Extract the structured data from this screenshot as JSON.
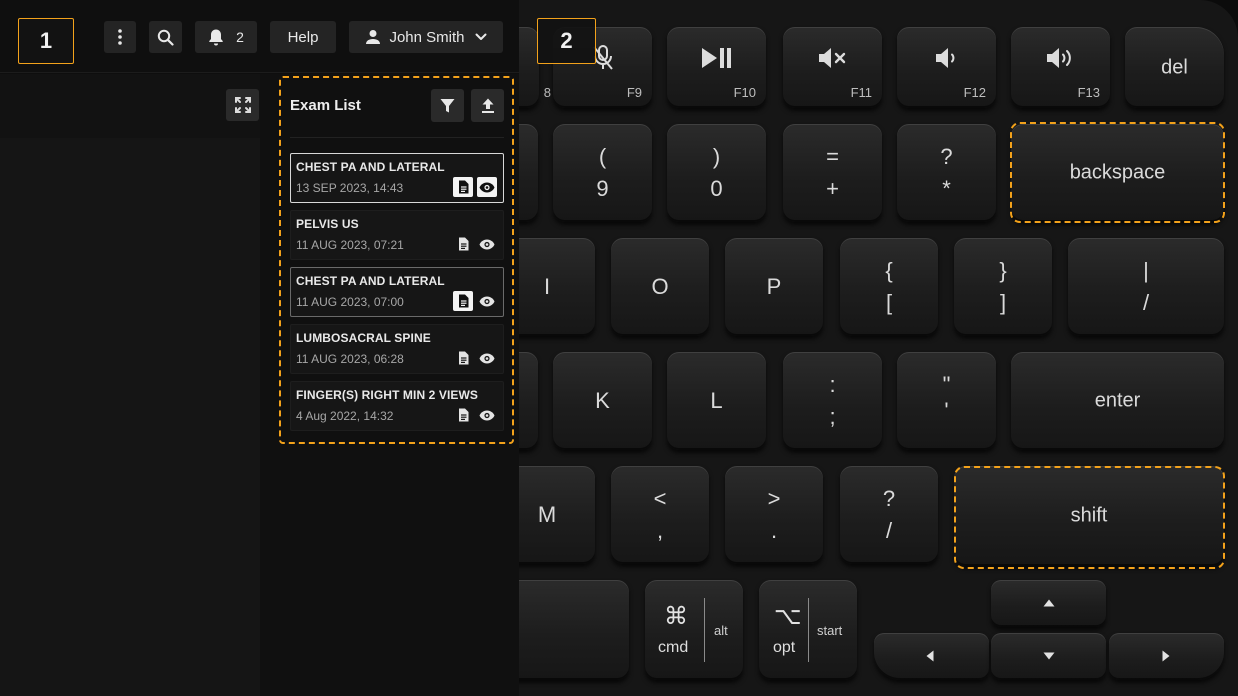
{
  "callouts": {
    "one": "1",
    "two": "2"
  },
  "topbar": {
    "notification_count": "2",
    "help_label": "Help",
    "user_name": "John Smith"
  },
  "exam_list": {
    "title": "Exam List",
    "items": [
      {
        "name": "CHEST PA AND LATERAL",
        "date": "13 SEP 2023, 14:43"
      },
      {
        "name": "PELVIS US",
        "date": "11 AUG 2023, 07:21"
      },
      {
        "name": "CHEST PA AND LATERAL",
        "date": "11 AUG 2023, 07:00"
      },
      {
        "name": "LUMBOSACRAL SPINE",
        "date": "11 AUG 2023, 06:28"
      },
      {
        "name": "FINGER(S) RIGHT MIN 2 VIEWS",
        "date": "4 Aug 2022, 14:32"
      }
    ]
  },
  "keyboard": {
    "row1": {
      "k8_fn": "8",
      "mic_fn": "F9",
      "play_fn": "F10",
      "mute_fn": "F11",
      "voldown_fn": "F12",
      "volup_fn": "F13",
      "del": "del"
    },
    "row2": {
      "nine_top": "(",
      "nine_bottom": "9",
      "zero_top": ")",
      "zero_bottom": "0",
      "equal_top": "=",
      "equal_bottom": "+",
      "star_top": "?",
      "star_bottom": "*",
      "backspace": "backspace"
    },
    "row3": {
      "i": "I",
      "o": "O",
      "p": "P",
      "brace_top": "{",
      "brace_bottom": "[",
      "cbrace_top": "}",
      "cbrace_bottom": "]",
      "pipe_top": "|",
      "pipe_bottom": "/"
    },
    "row4": {
      "k": "K",
      "l": "L",
      "colon_top": ":",
      "colon_bottom": ";",
      "quote_top": "\"",
      "quote_bottom": "'",
      "enter": "enter"
    },
    "row5": {
      "m": "M",
      "lt_top": "<",
      "lt_bottom": ",",
      "gt_top": ">",
      "gt_bottom": ".",
      "q_top": "?",
      "q_bottom": "/",
      "shift": "shift"
    },
    "row6": {
      "cmd_symbol": "⌘",
      "cmd": "cmd",
      "cmd_alt": "alt",
      "opt_symbol": "⌥",
      "opt": "opt",
      "opt_alt": "start"
    }
  },
  "colors": {
    "accent": "#f3a21b",
    "background": "#0e0e0e",
    "key": "#1f1f1f"
  }
}
